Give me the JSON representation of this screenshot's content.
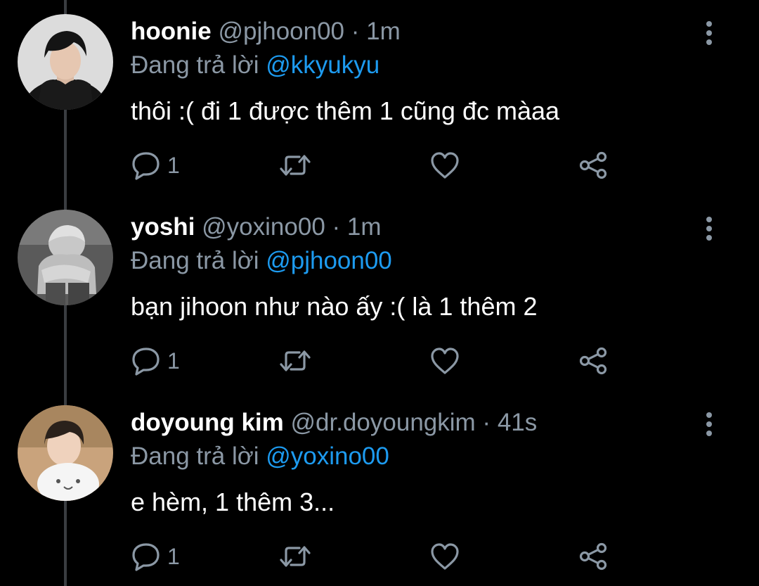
{
  "colors": {
    "background": "#000000",
    "text_primary": "#ffffff",
    "text_secondary": "#8b98a5",
    "mention_link": "#1d9bf0",
    "thread_line": "#3a3d41"
  },
  "icons": {
    "reply": "speech-bubble-icon",
    "retweet": "retweet-arrows-icon",
    "like": "heart-outline-icon",
    "share": "share-nodes-icon",
    "more": "vertical-ellipsis-icon"
  },
  "replying_prefix": "Đang trả lời",
  "tweets": [
    {
      "display_name": "hoonie",
      "handle": "@pjhoon00",
      "separator": "·",
      "time": "1m",
      "reply_to": "@kkyukyu",
      "text": "thôi :( đi 1 được thêm 1 cũng đc màaa",
      "reply_count": "1"
    },
    {
      "display_name": "yoshi",
      "handle": "@yoxino00",
      "separator": "·",
      "time": "1m",
      "reply_to": "@pjhoon00",
      "text": "bạn jihoon như nào ấy :( là 1 thêm 2",
      "reply_count": "1"
    },
    {
      "display_name": "doyoung kim",
      "handle": "@dr.doyoungkim",
      "separator": "·",
      "time": "41s",
      "reply_to": "@yoxino00",
      "text": "e hèm, 1 thêm 3...",
      "reply_count": "1"
    }
  ]
}
